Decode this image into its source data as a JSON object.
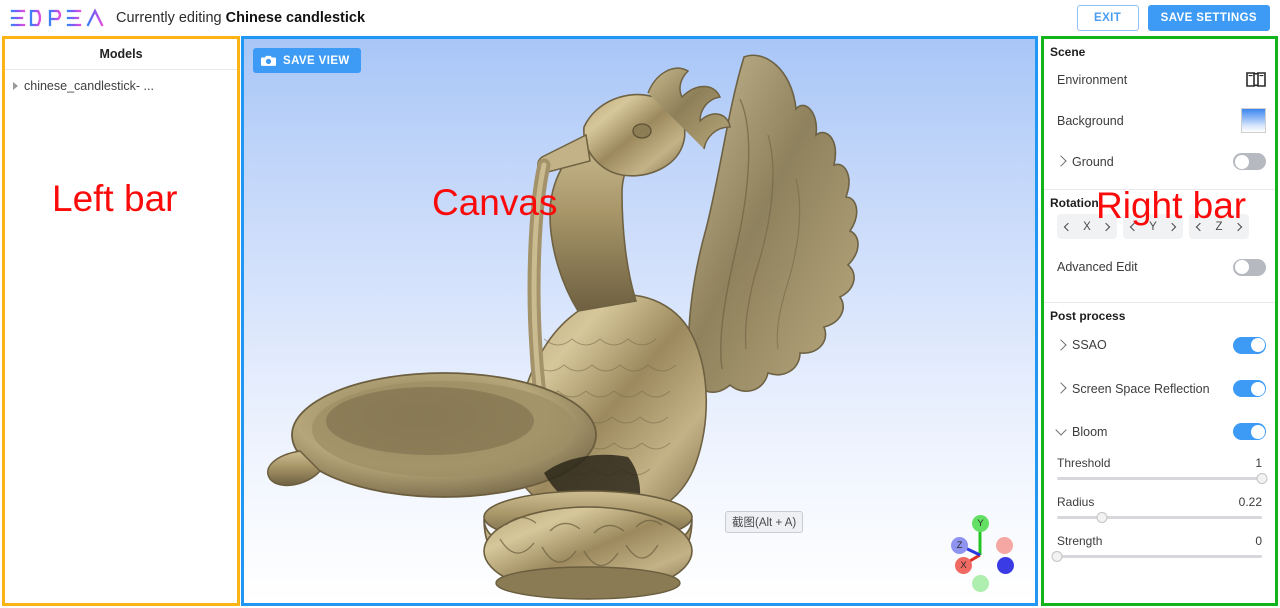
{
  "header": {
    "logo_text": "3DPEA",
    "title_prefix": "Currently editing",
    "title_model": "Chinese candlestick",
    "exit_label": "EXIT",
    "save_settings_label": "SAVE SETTINGS"
  },
  "leftbar": {
    "panel_title": "Models",
    "items": [
      {
        "label": "chinese_candlestick- ..."
      }
    ],
    "overlay": "Left bar",
    "border_color": "#fcb316"
  },
  "canvas": {
    "save_view_label": "SAVE VIEW",
    "camera_icon": "camera-icon",
    "screenshot_tooltip": "截图(Alt + A)",
    "overlay": "Canvas",
    "border_color": "#2196f3",
    "gizmo": {
      "axes": [
        {
          "label": "X",
          "color": "#e8392f"
        },
        {
          "label": "Y",
          "color": "#3ecc3e"
        },
        {
          "label": "Z",
          "color": "#5f63e8"
        }
      ]
    }
  },
  "rightbar": {
    "overlay": "Right bar",
    "border_color": "#13b31c",
    "sections": [
      {
        "title": "Scene",
        "rows": [
          {
            "label": "Environment",
            "control": "book-icon"
          },
          {
            "label": "Background",
            "control": "color-swatch"
          },
          {
            "label": "Ground",
            "control": "toggle",
            "expander": "right",
            "value": "off"
          }
        ]
      },
      {
        "title": "Rotation",
        "axes": [
          "X",
          "Y",
          "Z"
        ],
        "rows": [
          {
            "label": "Advanced Edit",
            "control": "toggle",
            "value": "off"
          }
        ]
      },
      {
        "title": "Post process",
        "rows": [
          {
            "label": "SSAO",
            "control": "toggle",
            "expander": "right",
            "value": "on"
          },
          {
            "label": "Screen Space Reflection",
            "control": "toggle",
            "expander": "right",
            "value": "on"
          },
          {
            "label": "Bloom",
            "control": "toggle",
            "expander": "down",
            "value": "on"
          }
        ],
        "sliders": [
          {
            "label": "Threshold",
            "value": "1",
            "percent": 100
          },
          {
            "label": "Radius",
            "value": "0.22",
            "percent": 22
          },
          {
            "label": "Strength",
            "value": "0",
            "percent": 0
          }
        ]
      }
    ]
  }
}
